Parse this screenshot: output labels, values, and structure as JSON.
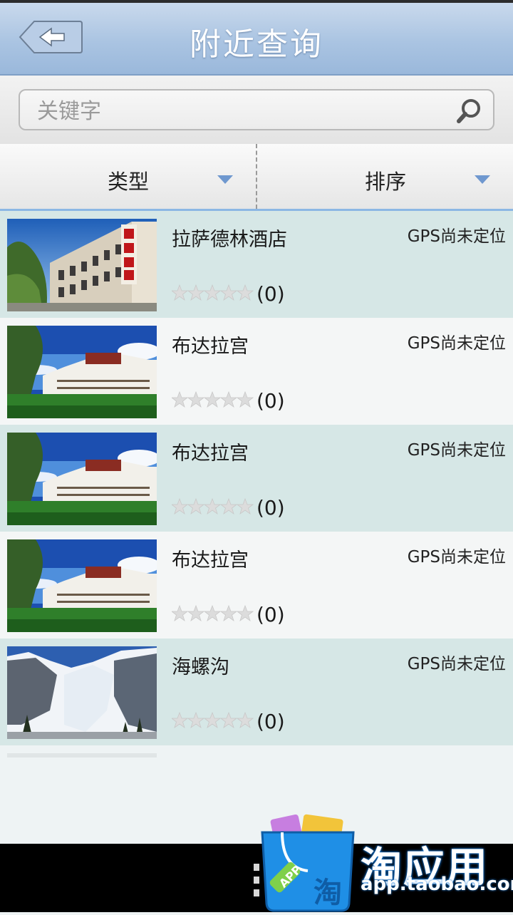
{
  "header": {
    "title": "附近查询",
    "back_icon": "back-arrow-icon"
  },
  "search": {
    "placeholder": "关键字",
    "value": ""
  },
  "filters": [
    {
      "label": "类型",
      "icon": "dropdown-arrow-icon"
    },
    {
      "label": "排序",
      "icon": "dropdown-arrow-icon"
    }
  ],
  "items": [
    {
      "title": "拉萨德林酒店",
      "status": "GPS尚未定位",
      "rating": 0,
      "count": "(0)",
      "image": "hotel-photo"
    },
    {
      "title": "布达拉宫",
      "status": "GPS尚未定位",
      "rating": 0,
      "count": "(0)",
      "image": "potala-palace-photo"
    },
    {
      "title": "布达拉宫",
      "status": "GPS尚未定位",
      "rating": 0,
      "count": "(0)",
      "image": "potala-palace-photo"
    },
    {
      "title": "布达拉宫",
      "status": "GPS尚未定位",
      "rating": 0,
      "count": "(0)",
      "image": "potala-palace-photo"
    },
    {
      "title": "海螺沟",
      "status": "GPS尚未定位",
      "rating": 0,
      "count": "(0)",
      "image": "glacier-photo"
    }
  ],
  "ad": {
    "brand": "淘应用",
    "url": "app.taobao.com",
    "bag_text": "淘",
    "bag_tag": "APP"
  },
  "colors": {
    "header": "#aac4e2",
    "row_alt": "#d6e7e6",
    "accent": "#6f98cf"
  }
}
